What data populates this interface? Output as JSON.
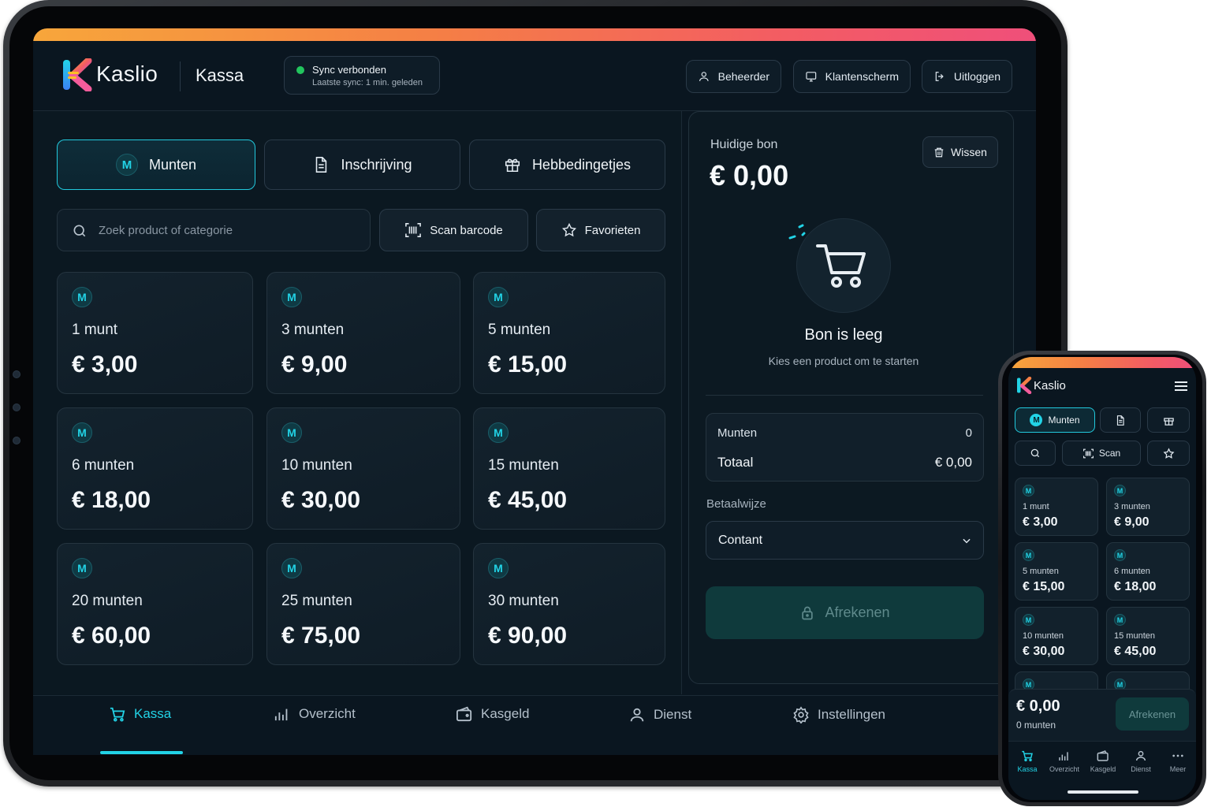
{
  "brand": {
    "name": "Kaslio",
    "section": "Kassa"
  },
  "sync": {
    "title": "Sync verbonden",
    "subtitle": "Laatste sync: 1 min. geleden",
    "status_color": "#22c55e"
  },
  "header_buttons": {
    "admin": "Beheerder",
    "customer_screen": "Klantenscherm",
    "logout": "Uitloggen"
  },
  "tabs": [
    {
      "label": "Munten",
      "active": true
    },
    {
      "label": "Inschrijving",
      "active": false
    },
    {
      "label": "Hebbedingetjes",
      "active": false
    }
  ],
  "search": {
    "placeholder": "Zoek product of categorie"
  },
  "tools": {
    "scan": "Scan barcode",
    "favorites": "Favorieten"
  },
  "coin_badge": "M",
  "products": [
    {
      "name": "1 munt",
      "price": "€ 3,00"
    },
    {
      "name": "3 munten",
      "price": "€ 9,00"
    },
    {
      "name": "5 munten",
      "price": "€ 15,00"
    },
    {
      "name": "6 munten",
      "price": "€ 18,00"
    },
    {
      "name": "10 munten",
      "price": "€ 30,00"
    },
    {
      "name": "15 munten",
      "price": "€ 45,00"
    },
    {
      "name": "20 munten",
      "price": "€ 60,00"
    },
    {
      "name": "25 munten",
      "price": "€ 75,00"
    },
    {
      "name": "30 munten",
      "price": "€ 90,00"
    }
  ],
  "receipt": {
    "title": "Huidige bon",
    "amount": "€ 0,00",
    "clear": "Wissen",
    "empty_title": "Bon is leeg",
    "empty_subtitle": "Kies een product om te starten",
    "coins_label": "Munten",
    "coins_value": "0",
    "total_label": "Totaal",
    "total_value": "€ 0,00",
    "payment_label": "Betaalwijze",
    "payment_value": "Contant",
    "checkout": "Afrekenen"
  },
  "bottom_nav": [
    {
      "label": "Kassa",
      "active": true
    },
    {
      "label": "Overzicht",
      "active": false
    },
    {
      "label": "Kasgeld",
      "active": false
    },
    {
      "label": "Dienst",
      "active": false
    },
    {
      "label": "Instellingen",
      "active": false
    }
  ],
  "phone": {
    "brand": "Kaslio",
    "tab_label": "Munten",
    "scan": "Scan",
    "products": [
      {
        "name": "1 munt",
        "price": "€ 3,00"
      },
      {
        "name": "3 munten",
        "price": "€ 9,00"
      },
      {
        "name": "5 munten",
        "price": "€ 15,00"
      },
      {
        "name": "6 munten",
        "price": "€ 18,00"
      },
      {
        "name": "10 munten",
        "price": "€ 30,00"
      },
      {
        "name": "15 munten",
        "price": "€ 45,00"
      }
    ],
    "total": "€ 0,00",
    "coins": "0 munten",
    "checkout": "Afrekenen",
    "nav": [
      {
        "label": "Kassa",
        "active": true
      },
      {
        "label": "Overzicht",
        "active": false
      },
      {
        "label": "Kasgeld",
        "active": false
      },
      {
        "label": "Dienst",
        "active": false
      },
      {
        "label": "Meer",
        "active": false
      }
    ]
  },
  "colors": {
    "accent": "#22d3e6",
    "bg": "#0a1620",
    "card": "#12212c",
    "checkout_disabled": "#0f3a3c"
  }
}
